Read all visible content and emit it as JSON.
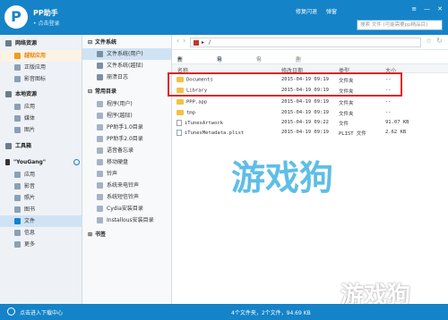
{
  "app": {
    "title": "PP助手",
    "login": "• 点击登录"
  },
  "topbar": {
    "links": [
      "修复闪退",
      "弹窗"
    ],
    "search_placeholder": "搜索 文件 (可能需要pp精品目)"
  },
  "sidebar1": {
    "sec_net": "网络资源",
    "net_items": [
      "越狱应用",
      "正版应用",
      "影音图标"
    ],
    "sec_local": "本地资源",
    "local_items": [
      "应用",
      "媒体",
      "图片"
    ],
    "toolbox": "工具箱",
    "device": "\"YouGang\"",
    "device_items": [
      "应用",
      "影音",
      "照片",
      "图书",
      "文件",
      "信息",
      "更多"
    ]
  },
  "sidebar2": {
    "sec_fs": "文件系统",
    "fs_items": [
      "文件系统(用户)",
      "文件系统(越狱)",
      "崩溃日志"
    ],
    "sec_common": "常用目录",
    "common_items": [
      "程序(用户)",
      "程序(越狱)",
      "PP助手1.0目录",
      "PP助手2.0目录",
      "语音备忘录",
      "移动硬盘",
      "铃声",
      "系统来电铃声",
      "系统短信铃声",
      "Cydia安装目录",
      "Installous安装目录"
    ],
    "sec_bookmark": "书签"
  },
  "main": {
    "path": "/",
    "tools": [
      "新建",
      "导入",
      "导出",
      "删除"
    ],
    "headers": [
      "名称",
      "修改日期",
      "类型",
      "大小"
    ],
    "rows": [
      {
        "name": "Documents",
        "date": "2015-04-19 09:19",
        "type": "文件夹",
        "size": "--",
        "kind": "folder"
      },
      {
        "name": "Library",
        "date": "2015-04-19 09:19",
        "type": "文件夹",
        "size": "--",
        "kind": "folder"
      },
      {
        "name": "PPP.app",
        "date": "2015-04-19 09:19",
        "type": "文件夹",
        "size": "--",
        "kind": "folder"
      },
      {
        "name": "tmp",
        "date": "2015-04-19 09:19",
        "type": "文件夹",
        "size": "--",
        "kind": "folder"
      },
      {
        "name": "iTunesArtwork",
        "date": "2015-04-19 09:22",
        "type": "文件",
        "size": "91.07 KB",
        "kind": "file"
      },
      {
        "name": "iTunesMetadata.plist",
        "date": "2015-04-19 09:19",
        "type": "PLIST 文件",
        "size": "2.62 KB",
        "kind": "file"
      }
    ]
  },
  "status": {
    "left": "点击进入下载中心",
    "center": "4个文件夹，2个文件，94.69 KB"
  },
  "watermark": {
    "center": "游戏狗",
    "corner": "游戏狗"
  },
  "colors": {
    "brand": "#1583c8",
    "highlight": "#e02020"
  }
}
